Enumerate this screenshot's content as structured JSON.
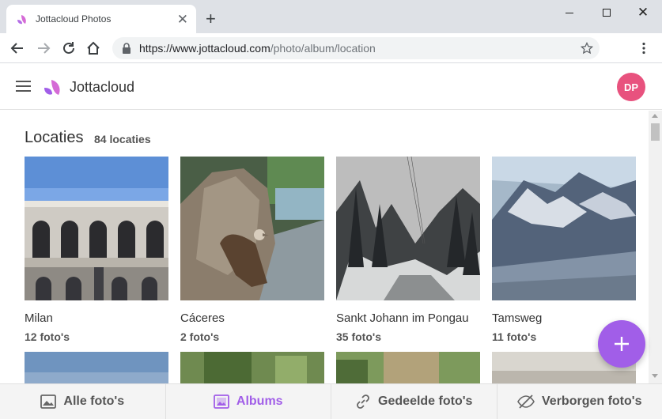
{
  "browser": {
    "tab_title": "Jottacloud Photos",
    "url_host": "https://www.jottacloud.com",
    "url_path": "/photo/album/location"
  },
  "app": {
    "brand": "Jottacloud",
    "avatar_initials": "DP",
    "accent_color": "#a15ee8",
    "avatar_color": "#e8527e"
  },
  "section": {
    "title": "Locaties",
    "count": "84 locaties"
  },
  "locations": [
    {
      "name": "Milan",
      "count": "12 foto's"
    },
    {
      "name": "Cáceres",
      "count": "2 foto's"
    },
    {
      "name": "Sankt Johann im Pongau",
      "count": "35 foto's"
    },
    {
      "name": "Tamsweg",
      "count": "11 foto's"
    }
  ],
  "bottom_nav": [
    {
      "label": "Alle foto's",
      "icon": "image-icon",
      "active": false
    },
    {
      "label": "Albums",
      "icon": "albums-icon",
      "active": true
    },
    {
      "label": "Gedeelde foto's",
      "icon": "link-icon",
      "active": false
    },
    {
      "label": "Verborgen foto's",
      "icon": "eye-off-icon",
      "active": false
    }
  ]
}
